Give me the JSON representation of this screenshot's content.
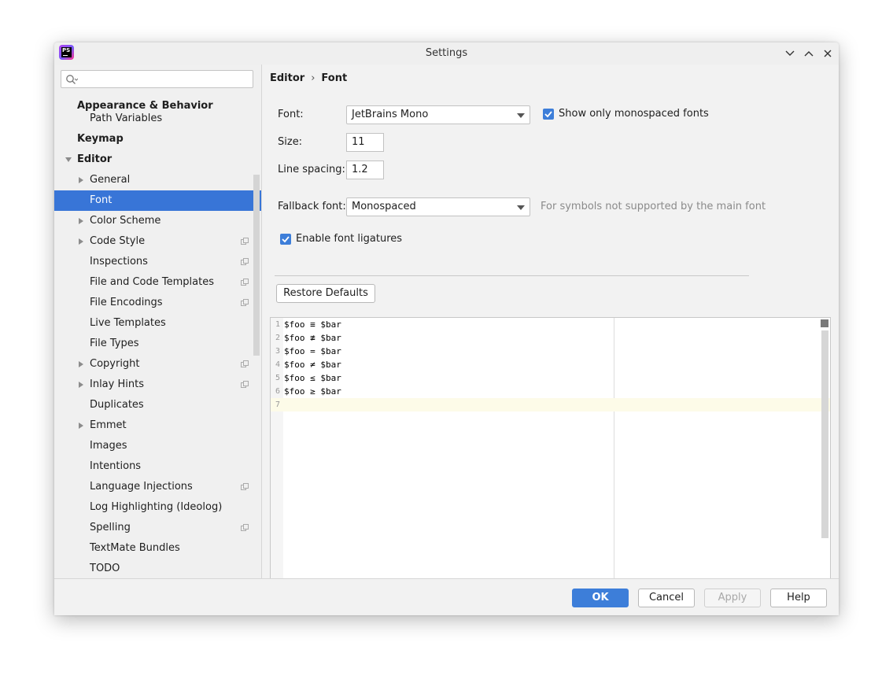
{
  "window": {
    "title": "Settings",
    "app_icon_text": "PS"
  },
  "search": {
    "placeholder": "",
    "value": ""
  },
  "sidebar": {
    "items": [
      {
        "label": "Appearance & Behavior"
      },
      {
        "label": "Path Variables"
      },
      {
        "label": "Keymap"
      },
      {
        "label": "Editor"
      },
      {
        "label": "General"
      },
      {
        "label": "Font"
      },
      {
        "label": "Color Scheme"
      },
      {
        "label": "Code Style"
      },
      {
        "label": "Inspections"
      },
      {
        "label": "File and Code Templates"
      },
      {
        "label": "File Encodings"
      },
      {
        "label": "Live Templates"
      },
      {
        "label": "File Types"
      },
      {
        "label": "Copyright"
      },
      {
        "label": "Inlay Hints"
      },
      {
        "label": "Duplicates"
      },
      {
        "label": "Emmet"
      },
      {
        "label": "Images"
      },
      {
        "label": "Intentions"
      },
      {
        "label": "Language Injections"
      },
      {
        "label": "Log Highlighting (Ideolog)"
      },
      {
        "label": "Spelling"
      },
      {
        "label": "TextMate Bundles"
      },
      {
        "label": "TODO"
      }
    ]
  },
  "breadcrumb": {
    "parent": "Editor",
    "separator": "›",
    "current": "Font"
  },
  "form": {
    "font_label": "Font:",
    "font_value": "JetBrains Mono",
    "mono_only_label": "Show only monospaced fonts",
    "size_label": "Size:",
    "size_value": "11",
    "line_spacing_label": "Line spacing:",
    "line_spacing_value": "1.2",
    "fallback_label": "Fallback font:",
    "fallback_value": "Monospaced",
    "fallback_hint": "For symbols not supported by the main font",
    "ligatures_label": "Enable font ligatures",
    "restore_defaults": "Restore Defaults"
  },
  "preview": {
    "lines": [
      {
        "n": "1",
        "code": "$foo ≡ $bar"
      },
      {
        "n": "2",
        "code": "$foo ≢ $bar"
      },
      {
        "n": "3",
        "code": "$foo = $bar"
      },
      {
        "n": "4",
        "code": "$foo ≠ $bar"
      },
      {
        "n": "5",
        "code": "$foo ≤ $bar"
      },
      {
        "n": "6",
        "code": "$foo ≥ $bar"
      },
      {
        "n": "7",
        "code": ""
      }
    ]
  },
  "footer": {
    "ok": "OK",
    "cancel": "Cancel",
    "apply": "Apply",
    "help": "Help"
  },
  "colors": {
    "accent": "#3d7ed9",
    "selection": "#3875d7",
    "current_line": "#fdfbe8"
  }
}
